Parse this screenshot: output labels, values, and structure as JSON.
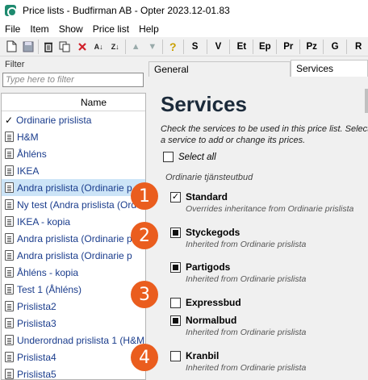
{
  "window": {
    "title": "Price lists - Budfirman AB - Opter 2023.12-01.83"
  },
  "menu": [
    "File",
    "Item",
    "Show",
    "Price list",
    "Help"
  ],
  "toolbar": {
    "icons": [
      "new-icon",
      "save-icon",
      "delete-icon",
      "copy-icon",
      "cancel-icon",
      "sort-asc-icon",
      "sort-desc-icon",
      "move-up-icon",
      "move-down-icon",
      "help-icon"
    ],
    "text_buttons": [
      "S",
      "V",
      "Et",
      "Ep",
      "Pr",
      "Pz",
      "G",
      "R"
    ]
  },
  "filter": {
    "label": "Filter",
    "placeholder": "Type here to filter",
    "value": ""
  },
  "list": {
    "header": "Name",
    "items": [
      {
        "label": "Ordinarie prislista",
        "checked": true
      },
      {
        "label": "H&M"
      },
      {
        "label": "Åhléns"
      },
      {
        "label": "IKEA"
      },
      {
        "label": "Andra prislista (Ordinarie p",
        "selected": true
      },
      {
        "label": "Ny test (Andra prislista (Ord"
      },
      {
        "label": "IKEA - kopia"
      },
      {
        "label": "Andra prislista (Ordinarie p"
      },
      {
        "label": "Andra prislista (Ordinarie p"
      },
      {
        "label": "Åhléns - kopia"
      },
      {
        "label": "Test 1 (Åhléns)"
      },
      {
        "label": "Prislista2"
      },
      {
        "label": "Prislista3"
      },
      {
        "label": "Underordnad prislista 1 (H&M"
      },
      {
        "label": "Prislista4"
      },
      {
        "label": "Prislista5"
      }
    ]
  },
  "tabs": {
    "general": "General",
    "services": "Services"
  },
  "services": {
    "title": "Services",
    "instructions": "Check the services to be used in this price list. Select a service to add or change its prices.",
    "select_all": "Select all",
    "section": "Ordinarie tjänsteutbud",
    "items": [
      {
        "label": "Standard",
        "sub": "Overrides inheritance from Ordinarie prislista",
        "state": "checked"
      },
      {
        "label": "Styckegods",
        "sub": "Inherited from Ordinarie prislista",
        "state": "filled"
      },
      {
        "label": "Partigods",
        "sub": "Inherited from Ordinarie prislista",
        "state": "filled"
      },
      {
        "label": "Expressbud",
        "sub": "",
        "state": "empty"
      },
      {
        "label": "Normalbud",
        "sub": "Inherited from Ordinarie prislista",
        "state": "filled"
      },
      {
        "label": "Kranbil",
        "sub": "Inherited from Ordinarie prislista",
        "state": "empty"
      }
    ]
  },
  "badges": [
    "1",
    "2",
    "3",
    "4"
  ],
  "colors": {
    "badge": "#ea5d1e",
    "selected_row": "#cce4f7",
    "app_icon": "#1e8a6f"
  }
}
